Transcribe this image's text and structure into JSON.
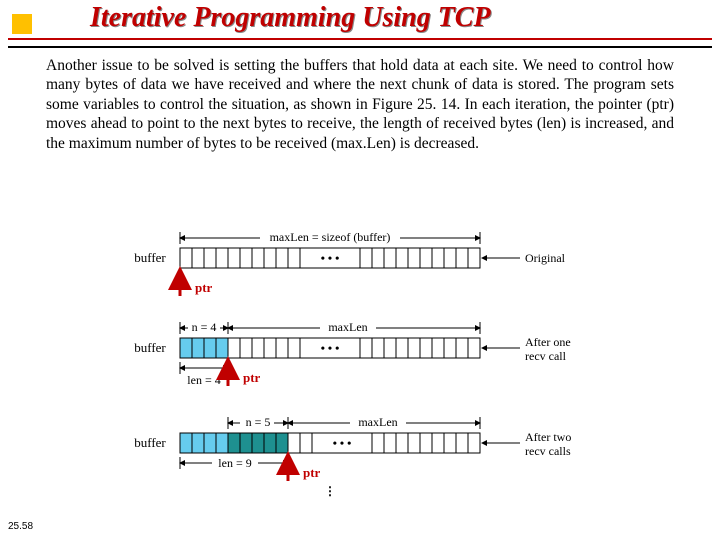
{
  "title": "Iterative Programming Using TCP",
  "paragraph": "Another issue to be solved is setting the buffers that hold data at each site. We need to control how many bytes of data we have received and where the next chunk of data is stored. The program sets some variables to control the situation, as shown in Figure 25. 14. In each iteration, the pointer (ptr) moves ahead to point to the next bytes to receive, the length of received bytes (len) is increased, and the maximum number of bytes to be received (max.Len) is decreased.",
  "page_number": "25.58",
  "diagram": {
    "maxlen_label": "maxLen = sizeof (buffer)",
    "buffer_label": "buffer",
    "ptr_label": "ptr",
    "state1": {
      "right_label": "Original"
    },
    "state2": {
      "n_label": "n = 4",
      "maxlen_label": "maxLen",
      "len_label": "len = 4",
      "right_label_1": "After one",
      "right_label_2": "recv call"
    },
    "state3": {
      "n_label": "n = 5",
      "maxlen_label": "maxLen",
      "len_label": "len = 9",
      "right_label_1": "After two",
      "right_label_2": "recv calls"
    }
  }
}
